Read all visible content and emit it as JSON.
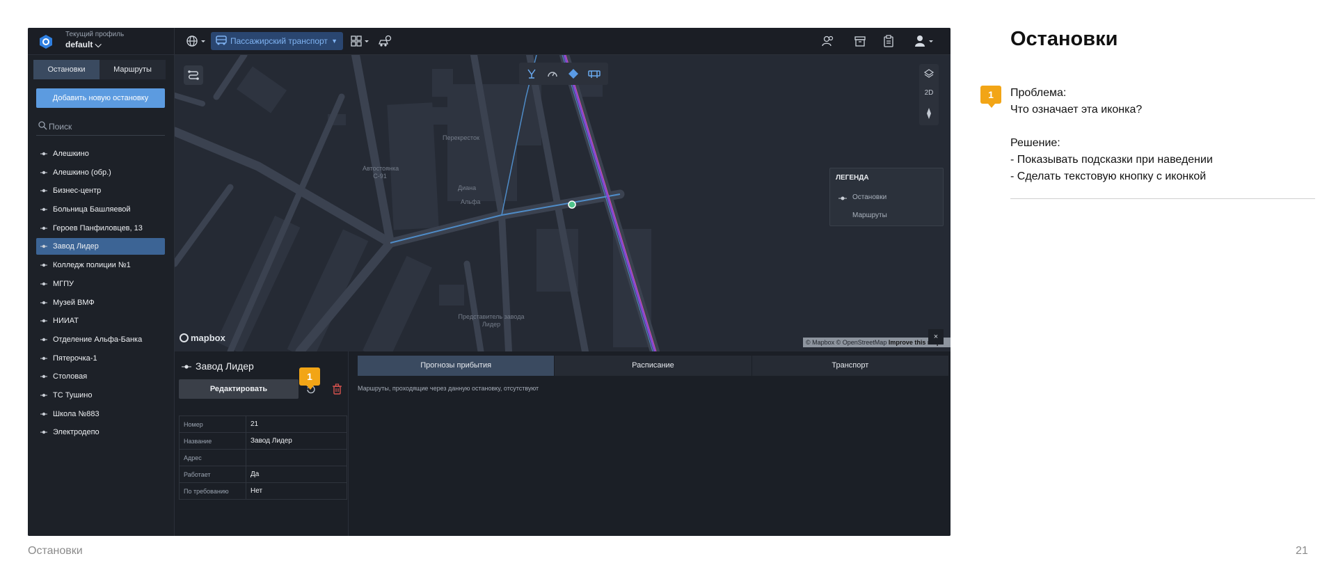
{
  "app": {
    "profile_label": "Текущий профиль",
    "profile_value": "default ⌵",
    "transport_mode": "Пассажирский транспорт",
    "tabs": [
      "Остановки",
      "Маршруты"
    ],
    "add_button": "Добавить новую остановку",
    "search_placeholder": "Поиск",
    "stops": [
      "Алешкино",
      "Алешкино (обр.)",
      "Бизнес-центр",
      "Больница Башляевой",
      "Героев Панфиловцев, 13",
      "Завод Лидер",
      "Колледж полиции №1",
      "МГПУ",
      "Музей ВМФ",
      "НИИАТ",
      "Отделение Альфа-Банка",
      "Пятерочка-1",
      "Столовая",
      "ТС Тушино",
      "Школа №883",
      "Электродепо"
    ],
    "selected_stop": "Завод Лидер",
    "map": {
      "labels": [
        "Перекресток",
        "Автостоянка С-91",
        "Диана",
        "Альфа",
        "Представитель завода Лидер"
      ],
      "mode_2d": "2D",
      "legend_title": "ЛЕГЕНДА",
      "legend_stops": "Остановки",
      "legend_routes": "Маршруты",
      "logo": "mapbox",
      "attribution": "© Mapbox © OpenStreetMap",
      "attribution_link": "Improve this map",
      "close": "×"
    },
    "details": {
      "title": "Завод Лидер",
      "edit_button": "Редактировать",
      "properties": [
        {
          "key": "Номер",
          "value": "21"
        },
        {
          "key": "Название",
          "value": "Завод Лидер"
        },
        {
          "key": "Адрес",
          "value": ""
        },
        {
          "key": "Работает",
          "value": "Да"
        },
        {
          "key": "По требованию",
          "value": "Нет"
        }
      ]
    },
    "forecast_tabs": [
      "Прогнозы прибытия",
      "Расписание",
      "Транспорт"
    ],
    "forecast_note": "Маршруты, проходящие через данную остановку, отсутствуют",
    "colors": {
      "accent": "#5c9be0",
      "selected": "#3c6495",
      "badge": "#f2a516",
      "delete": "#d9534f"
    }
  },
  "annotation": {
    "badge": "1",
    "problem_label": "Проблема:",
    "problem_text": "Что означает эта иконка?",
    "solution_label": "Решение:",
    "solution_1": "- Показывать подсказки при наведении",
    "solution_2": "- Сделать текстовую кнопку с иконкой"
  },
  "slide": {
    "title": "Остановки",
    "footer": "Остановки",
    "page_number": "21"
  }
}
